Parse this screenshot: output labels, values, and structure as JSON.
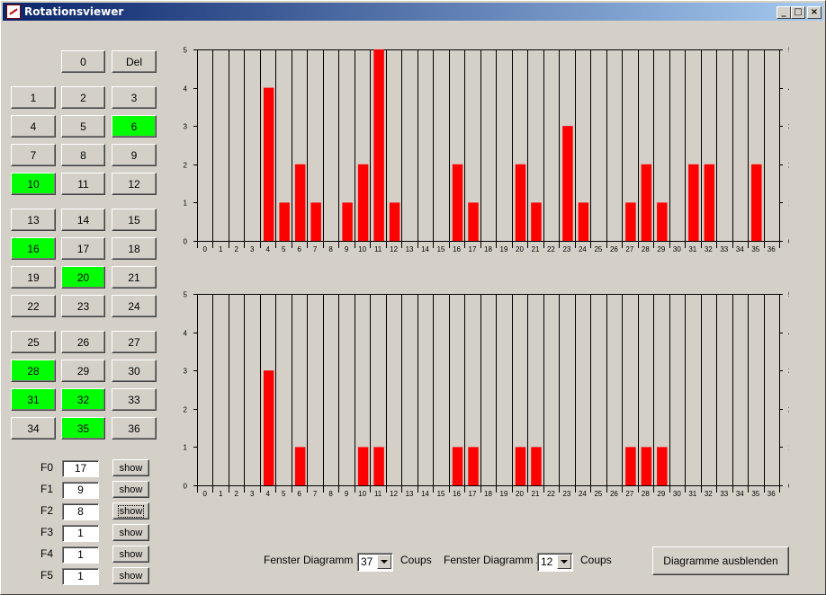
{
  "window": {
    "title": "Rotationsviewer",
    "controls": [
      "_",
      "□",
      "×"
    ]
  },
  "keypad": {
    "zero": "0",
    "del": "Del",
    "numbers": [
      {
        "n": "1",
        "on": false
      },
      {
        "n": "2",
        "on": false
      },
      {
        "n": "3",
        "on": false
      },
      {
        "n": "4",
        "on": false
      },
      {
        "n": "5",
        "on": false
      },
      {
        "n": "6",
        "on": true
      },
      {
        "n": "7",
        "on": false
      },
      {
        "n": "8",
        "on": false
      },
      {
        "n": "9",
        "on": false
      },
      {
        "n": "10",
        "on": true
      },
      {
        "n": "11",
        "on": false
      },
      {
        "n": "12",
        "on": false
      },
      {
        "n": "13",
        "on": false
      },
      {
        "n": "14",
        "on": false
      },
      {
        "n": "15",
        "on": false
      },
      {
        "n": "16",
        "on": true
      },
      {
        "n": "17",
        "on": false
      },
      {
        "n": "18",
        "on": false
      },
      {
        "n": "19",
        "on": false
      },
      {
        "n": "20",
        "on": true
      },
      {
        "n": "21",
        "on": false
      },
      {
        "n": "22",
        "on": false
      },
      {
        "n": "23",
        "on": false
      },
      {
        "n": "24",
        "on": false
      },
      {
        "n": "25",
        "on": false
      },
      {
        "n": "26",
        "on": false
      },
      {
        "n": "27",
        "on": false
      },
      {
        "n": "28",
        "on": true
      },
      {
        "n": "29",
        "on": false
      },
      {
        "n": "30",
        "on": false
      },
      {
        "n": "31",
        "on": true
      },
      {
        "n": "32",
        "on": true
      },
      {
        "n": "33",
        "on": false
      },
      {
        "n": "34",
        "on": false
      },
      {
        "n": "35",
        "on": true
      },
      {
        "n": "36",
        "on": false
      }
    ],
    "active_color": "#00ff00"
  },
  "filters": [
    {
      "label": "F0",
      "value": "17",
      "button": "show"
    },
    {
      "label": "F1",
      "value": "9",
      "button": "show"
    },
    {
      "label": "F2",
      "value": "8",
      "button": "show"
    },
    {
      "label": "F3",
      "value": "1",
      "button": "show"
    },
    {
      "label": "F4",
      "value": "1",
      "button": "show"
    },
    {
      "label": "F5",
      "value": "1",
      "button": "show"
    }
  ],
  "bottom": {
    "window1_label": "Fenster Diagramm 1",
    "window1_value": "37",
    "window1_unit": "Coups",
    "window2_label": "Fenster Diagramm 2",
    "window2_value": "12",
    "window2_unit": "Coups",
    "hide_button": "Diagramme ausblenden"
  },
  "chart_data": [
    {
      "type": "bar",
      "categories": [
        "0",
        "1",
        "2",
        "3",
        "4",
        "5",
        "6",
        "7",
        "8",
        "9",
        "10",
        "11",
        "12",
        "13",
        "14",
        "15",
        "16",
        "17",
        "18",
        "19",
        "20",
        "21",
        "22",
        "23",
        "24",
        "25",
        "26",
        "27",
        "28",
        "29",
        "30",
        "31",
        "32",
        "33",
        "34",
        "35",
        "36"
      ],
      "values": [
        0,
        0,
        0,
        0,
        4,
        1,
        2,
        1,
        0,
        1,
        2,
        5,
        1,
        0,
        0,
        0,
        2,
        1,
        0,
        0,
        2,
        1,
        0,
        3,
        1,
        0,
        0,
        1,
        2,
        1,
        0,
        2,
        2,
        0,
        0,
        2,
        0
      ],
      "ylim": [
        0,
        5
      ],
      "yticks": [
        0,
        1,
        2,
        3,
        4,
        5
      ],
      "bar_color": "#ff0000",
      "grid": true,
      "right_axis": true
    },
    {
      "type": "bar",
      "categories": [
        "0",
        "1",
        "2",
        "3",
        "4",
        "5",
        "6",
        "7",
        "8",
        "9",
        "10",
        "11",
        "12",
        "13",
        "14",
        "15",
        "16",
        "17",
        "18",
        "19",
        "20",
        "21",
        "22",
        "23",
        "24",
        "25",
        "26",
        "27",
        "28",
        "29",
        "30",
        "31",
        "32",
        "33",
        "34",
        "35",
        "36"
      ],
      "values": [
        0,
        0,
        0,
        0,
        3,
        0,
        1,
        0,
        0,
        0,
        1,
        1,
        0,
        0,
        0,
        0,
        1,
        1,
        0,
        0,
        1,
        1,
        0,
        0,
        0,
        0,
        0,
        1,
        1,
        1,
        0,
        0,
        0,
        0,
        0,
        0,
        0
      ],
      "ylim": [
        0,
        5
      ],
      "yticks": [
        0,
        1,
        2,
        3,
        4,
        5
      ],
      "bar_color": "#ff0000",
      "grid": true,
      "right_axis": true
    }
  ]
}
